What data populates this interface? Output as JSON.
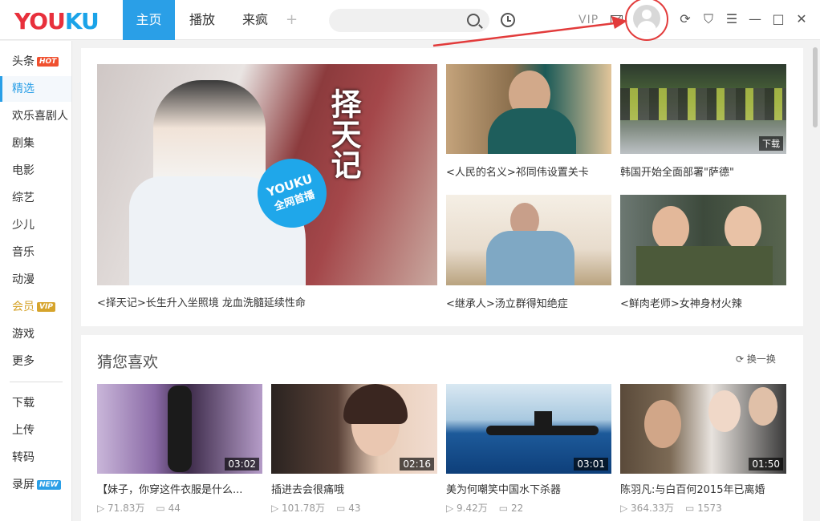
{
  "logo": {
    "part1": "YOU",
    "part2": "KU"
  },
  "nav": {
    "tabs": [
      "主页",
      "播放",
      "来疯"
    ],
    "plus": "+"
  },
  "header": {
    "vip": "VIP"
  },
  "window": {
    "refresh": "⟳",
    "skin": "⛉",
    "menu": "☰",
    "minimize": "—",
    "maximize": "□",
    "close": "✕"
  },
  "sidebar": {
    "items": [
      {
        "label": "头条",
        "badge": "HOT"
      },
      {
        "label": "精选"
      },
      {
        "label": "欢乐喜剧人"
      },
      {
        "label": "剧集"
      },
      {
        "label": "电影"
      },
      {
        "label": "综艺"
      },
      {
        "label": "少儿"
      },
      {
        "label": "音乐"
      },
      {
        "label": "动漫"
      },
      {
        "label": "会员",
        "badge": "VIP"
      },
      {
        "label": "游戏"
      },
      {
        "label": "更多"
      },
      {
        "label": "下载"
      },
      {
        "label": "上传"
      },
      {
        "label": "转码"
      },
      {
        "label": "录屏",
        "badge": "NEW"
      }
    ]
  },
  "featured": {
    "main": {
      "caption": "<择天记>长生升入坐照境 龙血洗髓延续性命",
      "badge_line1": "YOUKU",
      "badge_line2": "全网首播",
      "poster_title": "择天记"
    },
    "items": [
      {
        "caption": "<人民的名义>祁同伟设置关卡"
      },
      {
        "caption": "韩国开始全面部署\"萨德\"",
        "tag": "下载"
      },
      {
        "caption": "<继承人>汤立群得知绝症"
      },
      {
        "caption": "<鲜肉老师>女神身材火辣"
      }
    ]
  },
  "recommend": {
    "title": "猜您喜欢",
    "refresh": "换一换",
    "videos": [
      {
        "title": "【妹子，你穿这件衣服是什么...",
        "duration": "03:02",
        "plays": "71.83万",
        "comments": "44"
      },
      {
        "title": "插进去会很痛哦",
        "duration": "02:16",
        "plays": "101.78万",
        "comments": "43"
      },
      {
        "title": "美为何嘲笑中国水下杀器",
        "duration": "03:01",
        "plays": "9.42万",
        "comments": "22"
      },
      {
        "title": "陈羽凡:与白百何2015年已离婚",
        "duration": "01:50",
        "plays": "364.33万",
        "comments": "1573"
      }
    ]
  },
  "colors": {
    "accent": "#2a9fe7",
    "logo_red": "#e8303c",
    "annotation": "#e23b3b"
  }
}
